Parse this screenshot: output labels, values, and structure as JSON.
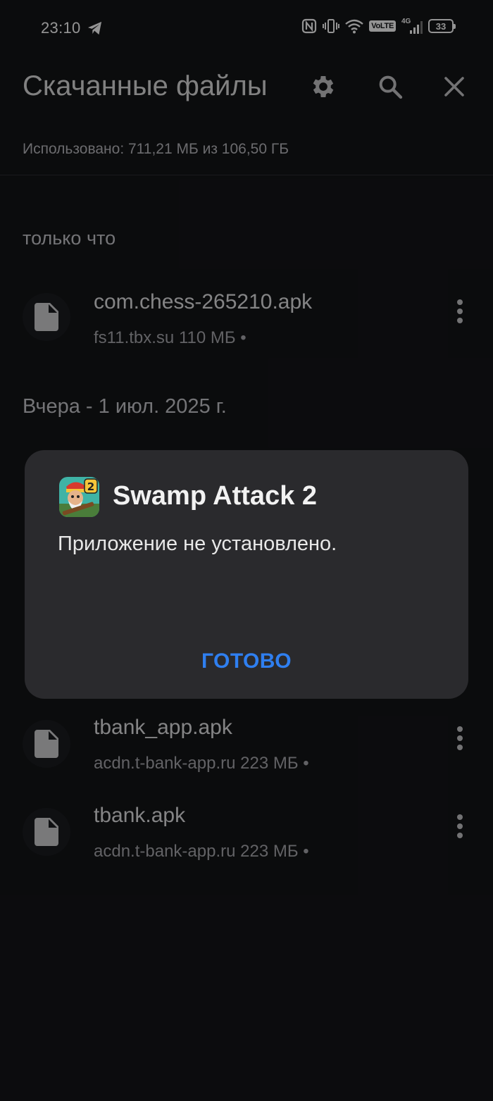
{
  "status_bar": {
    "time": "23:10",
    "volte": "VoLTE",
    "network": "4G",
    "battery": "33"
  },
  "app_bar": {
    "title": "Скачанные файлы",
    "icons": [
      "gear-icon",
      "search-icon",
      "close-icon"
    ]
  },
  "storage_text": "Использовано: 711,21 МБ из 106,50 ГБ",
  "sections": [
    {
      "header": "только что",
      "files": [
        {
          "name": "com.chess-265210.apk",
          "meta": "fs11.tbx.su 110 МБ •"
        }
      ]
    },
    {
      "header": "Вчера - 1 июл. 2025 г.",
      "files": [
        {
          "name": "tbank_app.apk",
          "meta": "acdn.t-bank-app.ru 223 МБ •"
        },
        {
          "name": "tbank.apk",
          "meta": "acdn.t-bank-app.ru 223 МБ •"
        }
      ]
    }
  ],
  "dialog": {
    "app_name": "Swamp Attack 2",
    "message": "Приложение не установлено.",
    "button": "ГОТОВО",
    "accent_color": "#2f7ff0"
  }
}
